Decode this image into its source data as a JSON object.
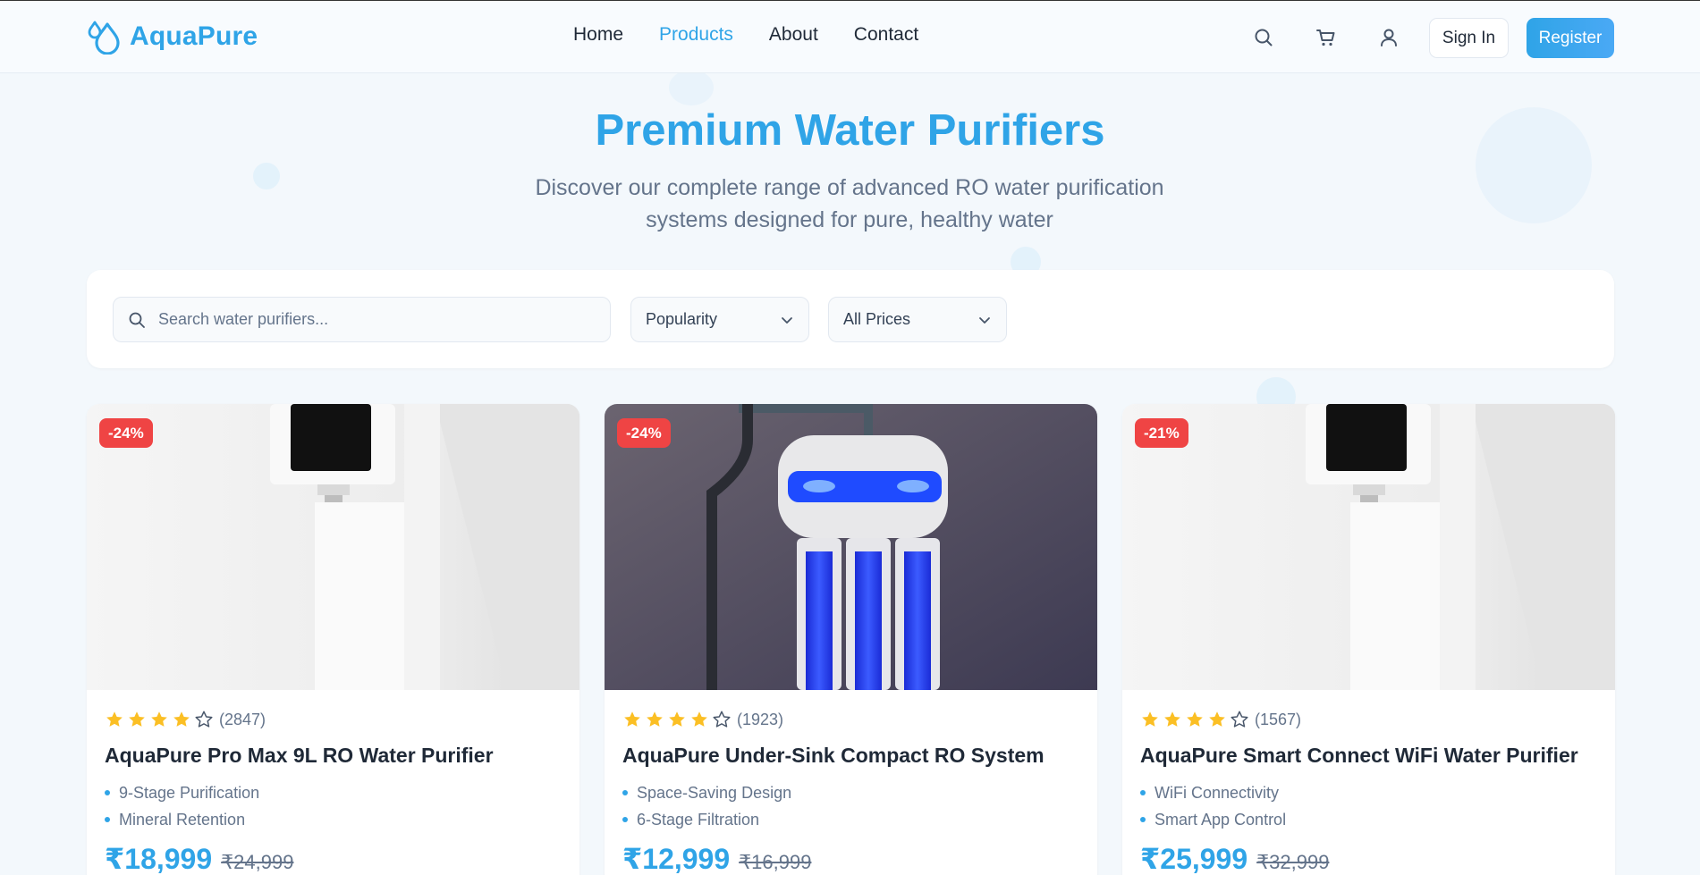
{
  "brand": {
    "name": "AquaPure",
    "color": "#2fa4e7"
  },
  "nav": [
    {
      "label": "Home",
      "active": false
    },
    {
      "label": "Products",
      "active": true
    },
    {
      "label": "About",
      "active": false
    },
    {
      "label": "Contact",
      "active": false
    }
  ],
  "header_icons": [
    "search-icon",
    "cart-icon",
    "user-icon"
  ],
  "auth": {
    "sign_in": "Sign In",
    "register": "Register"
  },
  "hero": {
    "title": "Premium Water Purifiers",
    "subtitle": "Discover our complete range of advanced RO water purification systems designed for pure, healthy water"
  },
  "filters": {
    "search_placeholder": "Search water purifiers...",
    "sort": "Popularity",
    "price": "All Prices"
  },
  "colors": {
    "accent": "#2fa4e7",
    "discount": "#ef4444",
    "star": "#fbbf24"
  },
  "products": [
    {
      "discount": "-24%",
      "rating": 4,
      "reviews": "(2847)",
      "title": "AquaPure Pro Max 9L RO Water Purifier",
      "features": [
        "9-Stage Purification",
        "Mineral Retention"
      ],
      "price": "₹18,999",
      "mrp": "₹24,999"
    },
    {
      "discount": "-24%",
      "rating": 4,
      "reviews": "(1923)",
      "title": "AquaPure Under-Sink Compact RO System",
      "features": [
        "Space-Saving Design",
        "6-Stage Filtration"
      ],
      "price": "₹12,999",
      "mrp": "₹16,999"
    },
    {
      "discount": "-21%",
      "rating": 4,
      "reviews": "(1567)",
      "title": "AquaPure Smart Connect WiFi Water Purifier",
      "features": [
        "WiFi Connectivity",
        "Smart App Control"
      ],
      "price": "₹25,999",
      "mrp": "₹32,999"
    }
  ]
}
